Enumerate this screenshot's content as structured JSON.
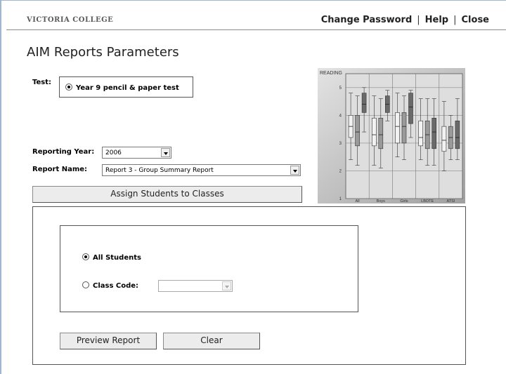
{
  "header": {
    "college": "VICTORIA COLLEGE",
    "links": [
      "Change Password",
      "Help",
      "Close"
    ],
    "separator": "|"
  },
  "page": {
    "title": "AIM Reports Parameters"
  },
  "form": {
    "test_label": "Test:",
    "test_option": "Year 9 pencil & paper test",
    "test_selected": true,
    "reporting_year_label": "Reporting Year:",
    "reporting_year_value": "2006",
    "report_name_label": "Report Name:",
    "report_name_value": "Report 3 - Group Summary Report",
    "assign_button": "Assign Students to Classes"
  },
  "filter": {
    "all_students_label": "All Students",
    "all_students_selected": true,
    "class_code_label": "Class Code:",
    "class_code_selected": false,
    "class_code_value": ""
  },
  "actions": {
    "preview": "Preview Report",
    "clear": "Clear"
  },
  "chart_data": {
    "type": "box",
    "title": "READING",
    "categories": [
      "All",
      "Boys",
      "Girls",
      "LBOTE",
      "ATSI"
    ],
    "ylim": [
      1,
      5.5
    ],
    "y_ticks": [
      1,
      2,
      3,
      4,
      5
    ],
    "grid": true,
    "series": [
      {
        "color": "#f2f2f2",
        "boxes": [
          {
            "q1": 3.2,
            "median": 3.6,
            "q3": 4.0,
            "min": 2.4,
            "max": 4.8
          },
          {
            "q1": 2.9,
            "median": 3.3,
            "q3": 3.9,
            "min": 2.2,
            "max": 4.7
          },
          {
            "q1": 3.0,
            "median": 3.6,
            "q3": 4.1,
            "min": 2.5,
            "max": 4.8
          },
          {
            "q1": 2.9,
            "median": 3.2,
            "q3": 3.8,
            "min": 2.4,
            "max": 4.6
          },
          {
            "q1": 2.7,
            "median": 3.1,
            "q3": 3.6,
            "min": 2.0,
            "max": 4.5
          }
        ]
      },
      {
        "color": "#9a9a9a",
        "boxes": [
          {
            "q1": 2.9,
            "median": 3.4,
            "q3": 4.0,
            "min": 2.2,
            "max": 4.7
          },
          {
            "q1": 2.8,
            "median": 3.3,
            "q3": 3.9,
            "min": 2.1,
            "max": 4.6
          },
          {
            "q1": 3.0,
            "median": 3.6,
            "q3": 4.1,
            "min": 2.4,
            "max": 4.7
          },
          {
            "q1": 2.8,
            "median": 3.3,
            "q3": 3.8,
            "min": 2.2,
            "max": 4.6
          },
          {
            "q1": 2.8,
            "median": 3.2,
            "q3": 3.6,
            "min": 2.4,
            "max": 4.0
          }
        ]
      },
      {
        "color": "#6a6a6a",
        "boxes": [
          {
            "q1": 4.1,
            "median": 4.4,
            "q3": 4.8,
            "min": 3.4,
            "max": 5.0
          },
          {
            "q1": 4.1,
            "median": 4.4,
            "q3": 4.7,
            "min": 3.8,
            "max": 4.9
          },
          {
            "q1": 3.7,
            "median": 4.3,
            "q3": 4.8,
            "min": 3.2,
            "max": 4.9
          },
          {
            "q1": 2.8,
            "median": 3.4,
            "q3": 3.9,
            "min": 2.2,
            "max": 4.6
          },
          {
            "q1": 2.8,
            "median": 3.2,
            "q3": 3.8,
            "min": 2.4,
            "max": 4.6
          }
        ]
      }
    ]
  }
}
